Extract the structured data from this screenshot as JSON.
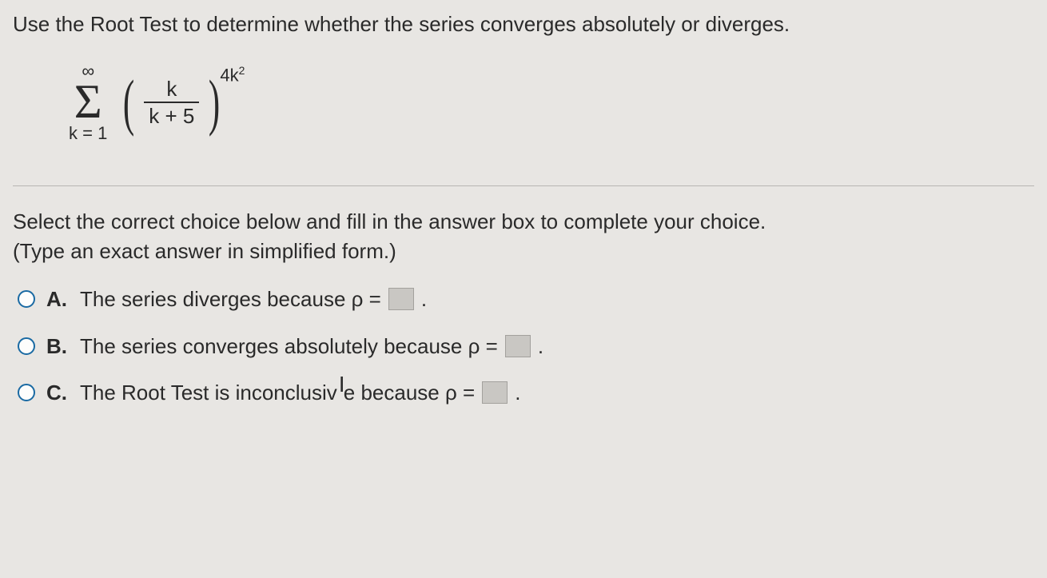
{
  "question": "Use the Root Test to determine whether the series converges absolutely or diverges.",
  "formula": {
    "sigma_top": "∞",
    "sigma_bottom": "k = 1",
    "numerator": "k",
    "denominator": "k + 5",
    "exponent_base": "4k",
    "exponent_power": "2"
  },
  "instruction_line1": "Select the correct choice below and fill in the answer box to complete your choice.",
  "instruction_line2": "(Type an exact answer in simplified form.)",
  "choices": {
    "a": {
      "label": "A.",
      "text_before": "The series diverges because ρ =",
      "text_after": "."
    },
    "b": {
      "label": "B.",
      "text_before": "The series converges absolutely because ρ =",
      "text_after": "."
    },
    "c": {
      "label": "C.",
      "text_before_1": "The Root Test is inconclusiv",
      "text_before_2": "e because ρ =",
      "text_after": "."
    }
  }
}
